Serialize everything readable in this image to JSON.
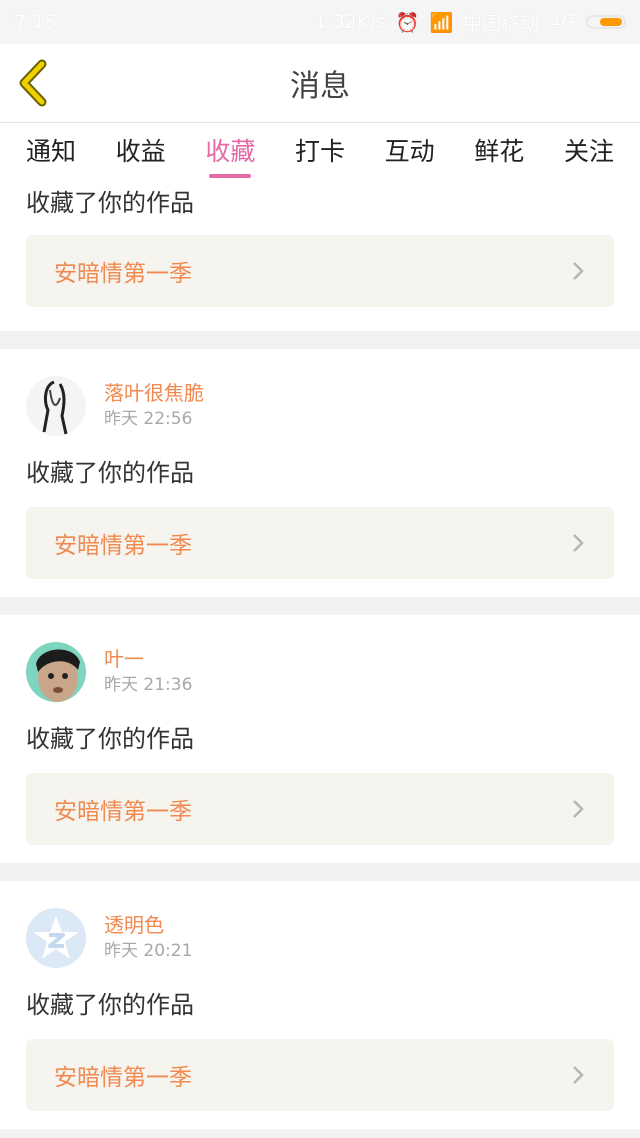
{
  "statusbar": {
    "time": "7:15",
    "speed": "1.32K/s",
    "carrier": "中国移动",
    "network": "4G"
  },
  "header": {
    "title": "消息"
  },
  "tabs": [
    {
      "label": "通知"
    },
    {
      "label": "收益"
    },
    {
      "label": "收藏",
      "active": true
    },
    {
      "label": "打卡"
    },
    {
      "label": "互动"
    },
    {
      "label": "鲜花"
    },
    {
      "label": "关注"
    }
  ],
  "first_card": {
    "message": "收藏了你的作品",
    "work_title": "安暗情第一季"
  },
  "notifications": [
    {
      "name": "落叶很焦脆",
      "time": "昨天 22:56",
      "message": "收藏了你的作品",
      "work_title": "安暗情第一季"
    },
    {
      "name": "叶一",
      "time": "昨天 21:36",
      "message": "收藏了你的作品",
      "work_title": "安暗情第一季"
    },
    {
      "name": "透明色",
      "time": "昨天 20:21",
      "message": "收藏了你的作品",
      "work_title": "安暗情第一季"
    }
  ],
  "colors": {
    "accent_pink": "#e66aa8",
    "accent_orange": "#f08a50",
    "back_arrow": "#f0b400"
  }
}
